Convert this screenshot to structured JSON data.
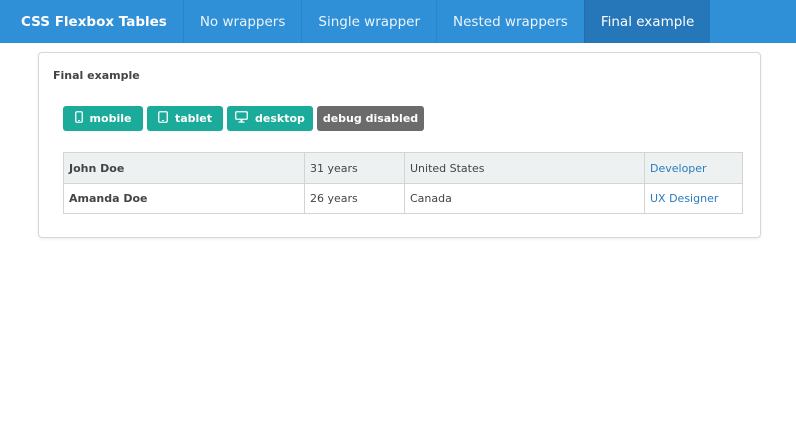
{
  "navbar": {
    "brand": "CSS Flexbox Tables",
    "items": [
      {
        "label": "No wrappers"
      },
      {
        "label": "Single wrapper"
      },
      {
        "label": "Nested wrappers"
      },
      {
        "label": "Final example",
        "active": true
      }
    ]
  },
  "card": {
    "title": "Final example",
    "buttons": [
      {
        "label": "mobile",
        "icon": "mobile-icon"
      },
      {
        "label": "tablet",
        "icon": "tablet-icon"
      },
      {
        "label": "desktop",
        "icon": "desktop-icon"
      },
      {
        "label": "debug disabled"
      }
    ]
  },
  "table": {
    "rows": [
      {
        "name": "John Doe",
        "age": "31 years",
        "country": "United States",
        "role": "Developer"
      },
      {
        "name": "Amanda Doe",
        "age": "26 years",
        "country": "Canada",
        "role": "UX Designer"
      }
    ]
  },
  "colors": {
    "navbar": "#2f8fd7",
    "nav_active": "#2577b9",
    "button_teal": "#1aab9b",
    "button_gray": "#6b6b6b",
    "link": "#2a7bbf",
    "row_stripe": "#eef1f1"
  }
}
